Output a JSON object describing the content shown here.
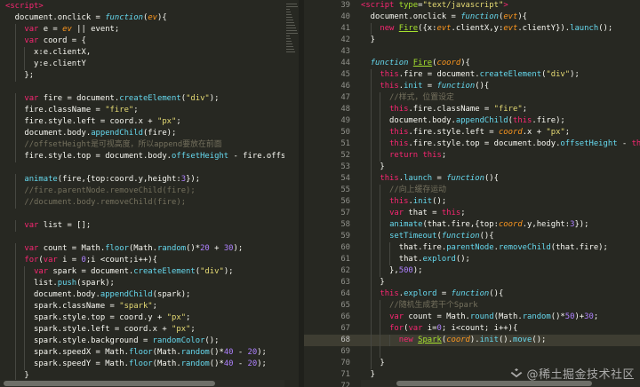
{
  "left_editor": {
    "lines": [
      [
        [
          "<",
          "tg"
        ],
        [
          "script",
          "tg"
        ],
        [
          ">",
          "tg"
        ]
      ],
      [
        [
          "  document.onclick = ",
          "pu"
        ],
        [
          "function",
          "it"
        ],
        [
          "(",
          "pu"
        ],
        [
          "ev",
          "pa"
        ],
        [
          "){",
          "pu"
        ]
      ],
      [
        [
          "    ",
          "pu"
        ],
        [
          "var",
          "kw"
        ],
        [
          " e = ",
          "pu"
        ],
        [
          "ev",
          "pa"
        ],
        [
          " || event;",
          "pu"
        ]
      ],
      [
        [
          "    ",
          "pu"
        ],
        [
          "var",
          "kw"
        ],
        [
          " coord = {",
          "pu"
        ]
      ],
      [
        [
          "      x:e.clientX,",
          "pu"
        ]
      ],
      [
        [
          "      y:e.clientY",
          "pu"
        ]
      ],
      [
        [
          "    };",
          "pu"
        ]
      ],
      [
        [
          "",
          "pu"
        ]
      ],
      [
        [
          "    ",
          "pu"
        ],
        [
          "var",
          "kw"
        ],
        [
          " fire = document.",
          "pu"
        ],
        [
          "createElement",
          "fn"
        ],
        [
          "(",
          "pu"
        ],
        [
          "\"div\"",
          "st"
        ],
        [
          ");",
          "pu"
        ]
      ],
      [
        [
          "    fire.className = ",
          "pu"
        ],
        [
          "\"fire\"",
          "st"
        ],
        [
          ";",
          "pu"
        ]
      ],
      [
        [
          "    fire.style.left = coord.x + ",
          "pu"
        ],
        [
          "\"px\"",
          "st"
        ],
        [
          ";",
          "pu"
        ]
      ],
      [
        [
          "    document.body.",
          "pu"
        ],
        [
          "appendChild",
          "fn"
        ],
        [
          "(fire);",
          "pu"
        ]
      ],
      [
        [
          "    //offsetHeight是可视高度，所以append要放在前面",
          "cm"
        ]
      ],
      [
        [
          "    fire.style.top = document.body.",
          "pu"
        ],
        [
          "offsetHeight",
          "fn"
        ],
        [
          " - fire.offse",
          "pu"
        ]
      ],
      [
        [
          "",
          "pu"
        ]
      ],
      [
        [
          "    ",
          "pu"
        ],
        [
          "animate",
          "fn"
        ],
        [
          "(fire,{top:coord.y,height:",
          "pu"
        ],
        [
          "3",
          "nu"
        ],
        [
          "});",
          "pu"
        ]
      ],
      [
        [
          "    //fire.parentNode.removeChild(fire);",
          "cm"
        ]
      ],
      [
        [
          "    //document.body.removeChild(fire);",
          "cm"
        ]
      ],
      [
        [
          "",
          "pu"
        ]
      ],
      [
        [
          "    ",
          "pu"
        ],
        [
          "var",
          "kw"
        ],
        [
          " list = [];",
          "pu"
        ]
      ],
      [
        [
          "",
          "pu"
        ]
      ],
      [
        [
          "    ",
          "pu"
        ],
        [
          "var",
          "kw"
        ],
        [
          " count = Math.",
          "pu"
        ],
        [
          "floor",
          "fn"
        ],
        [
          "(Math.",
          "pu"
        ],
        [
          "random",
          "fn"
        ],
        [
          "()*",
          "pu"
        ],
        [
          "20",
          "nu"
        ],
        [
          " + ",
          "pu"
        ],
        [
          "30",
          "nu"
        ],
        [
          ");",
          "pu"
        ]
      ],
      [
        [
          "    ",
          "pu"
        ],
        [
          "for",
          "kw"
        ],
        [
          "(",
          "pu"
        ],
        [
          "var",
          "kw"
        ],
        [
          " i = ",
          "pu"
        ],
        [
          "0",
          "nu"
        ],
        [
          ";i <count;i++){",
          "pu"
        ]
      ],
      [
        [
          "      ",
          "pu"
        ],
        [
          "var",
          "kw"
        ],
        [
          " spark = document.",
          "pu"
        ],
        [
          "createElement",
          "fn"
        ],
        [
          "(",
          "pu"
        ],
        [
          "\"div\"",
          "st"
        ],
        [
          ");",
          "pu"
        ]
      ],
      [
        [
          "      list.",
          "pu"
        ],
        [
          "push",
          "fn"
        ],
        [
          "(spark);",
          "pu"
        ]
      ],
      [
        [
          "      document.body.",
          "pu"
        ],
        [
          "appendChild",
          "fn"
        ],
        [
          "(spark);",
          "pu"
        ]
      ],
      [
        [
          "      spark.className = ",
          "pu"
        ],
        [
          "\"spark\"",
          "st"
        ],
        [
          ";",
          "pu"
        ]
      ],
      [
        [
          "      spark.style.top = coord.y + ",
          "pu"
        ],
        [
          "\"px\"",
          "st"
        ],
        [
          ";",
          "pu"
        ]
      ],
      [
        [
          "      spark.style.left = coord.x + ",
          "pu"
        ],
        [
          "\"px\"",
          "st"
        ],
        [
          ";",
          "pu"
        ]
      ],
      [
        [
          "      spark.style.background = ",
          "pu"
        ],
        [
          "randomColor",
          "fn"
        ],
        [
          "();",
          "pu"
        ]
      ],
      [
        [
          "      spark.speedX = Math.",
          "pu"
        ],
        [
          "floor",
          "fn"
        ],
        [
          "(Math.",
          "pu"
        ],
        [
          "random",
          "fn"
        ],
        [
          "()*",
          "pu"
        ],
        [
          "40",
          "nu"
        ],
        [
          " - ",
          "pu"
        ],
        [
          "20",
          "nu"
        ],
        [
          ");",
          "pu"
        ]
      ],
      [
        [
          "      spark.speedY = Math.",
          "pu"
        ],
        [
          "floor",
          "fn"
        ],
        [
          "(Math.",
          "pu"
        ],
        [
          "random",
          "fn"
        ],
        [
          "()*",
          "pu"
        ],
        [
          "40",
          "nu"
        ],
        [
          " - ",
          "pu"
        ],
        [
          "20",
          "nu"
        ],
        [
          ");",
          "pu"
        ]
      ],
      [
        [
          "    }",
          "pu"
        ]
      ],
      [
        [
          "      ",
          "pu"
        ]
      ]
    ]
  },
  "right_editor": {
    "active_line": 68,
    "lines": [
      {
        "n": "39",
        "t": [
          [
            "<",
            "tg"
          ],
          [
            "script",
            "tg"
          ],
          [
            " ",
            "pu"
          ],
          [
            "type",
            "at"
          ],
          [
            "=",
            "pu"
          ],
          [
            "\"text/javascript\"",
            "st"
          ],
          [
            ">",
            "tg"
          ]
        ]
      },
      {
        "n": "40",
        "t": [
          [
            "  document.onclick = ",
            "pu"
          ],
          [
            "function",
            "it"
          ],
          [
            "(",
            "pu"
          ],
          [
            "evt",
            "pa"
          ],
          [
            "){",
            "pu"
          ]
        ]
      },
      {
        "n": "41",
        "t": [
          [
            "    ",
            "pu"
          ],
          [
            "new",
            "kw"
          ],
          [
            " ",
            "pu"
          ],
          [
            "Fire",
            "cl"
          ],
          [
            "({x:",
            "pu"
          ],
          [
            "evt",
            "pa"
          ],
          [
            ".clientX,y:",
            "pu"
          ],
          [
            "evt",
            "pa"
          ],
          [
            ".clientY}).",
            "pu"
          ],
          [
            "launch",
            "fn"
          ],
          [
            "();",
            "pu"
          ]
        ]
      },
      {
        "n": "42",
        "t": [
          [
            "  }",
            "pu"
          ]
        ]
      },
      {
        "n": "43",
        "t": [
          [
            "",
            "pu"
          ]
        ]
      },
      {
        "n": "44",
        "t": [
          [
            "  ",
            "pu"
          ],
          [
            "function",
            "it"
          ],
          [
            " ",
            "pu"
          ],
          [
            "Fire",
            "cl"
          ],
          [
            "(",
            "pu"
          ],
          [
            "coord",
            "pa"
          ],
          [
            "){",
            "pu"
          ]
        ]
      },
      {
        "n": "45",
        "t": [
          [
            "    ",
            "pu"
          ],
          [
            "this",
            "kw"
          ],
          [
            ".fire = document.",
            "pu"
          ],
          [
            "createElement",
            "fn"
          ],
          [
            "(",
            "pu"
          ],
          [
            "\"div\"",
            "st"
          ],
          [
            ");",
            "pu"
          ]
        ]
      },
      {
        "n": "46",
        "t": [
          [
            "    ",
            "pu"
          ],
          [
            "this",
            "kw"
          ],
          [
            ".",
            "pu"
          ],
          [
            "init",
            "fn"
          ],
          [
            " = ",
            "pu"
          ],
          [
            "function",
            "it"
          ],
          [
            "(){",
            "pu"
          ]
        ]
      },
      {
        "n": "47",
        "t": [
          [
            "      //样式，位置设定",
            "cm"
          ]
        ]
      },
      {
        "n": "48",
        "t": [
          [
            "      ",
            "pu"
          ],
          [
            "this",
            "kw"
          ],
          [
            ".fire.className = ",
            "pu"
          ],
          [
            "\"fire\"",
            "st"
          ],
          [
            ";",
            "pu"
          ]
        ]
      },
      {
        "n": "49",
        "t": [
          [
            "      document.body.",
            "pu"
          ],
          [
            "appendChild",
            "fn"
          ],
          [
            "(",
            "pu"
          ],
          [
            "this",
            "kw"
          ],
          [
            ".fire);",
            "pu"
          ]
        ]
      },
      {
        "n": "50",
        "t": [
          [
            "      ",
            "pu"
          ],
          [
            "this",
            "kw"
          ],
          [
            ".fire.style.left = ",
            "pu"
          ],
          [
            "coord",
            "pa"
          ],
          [
            ".x + ",
            "pu"
          ],
          [
            "\"px\"",
            "st"
          ],
          [
            ";",
            "pu"
          ]
        ]
      },
      {
        "n": "51",
        "t": [
          [
            "      ",
            "pu"
          ],
          [
            "this",
            "kw"
          ],
          [
            ".fire.style.top = document.body.",
            "pu"
          ],
          [
            "offsetHeight",
            "fn"
          ],
          [
            " - ",
            "pu"
          ],
          [
            "this",
            "kw"
          ]
        ]
      },
      {
        "n": "52",
        "t": [
          [
            "      ",
            "pu"
          ],
          [
            "return",
            "kw"
          ],
          [
            " ",
            "pu"
          ],
          [
            "this",
            "kw"
          ],
          [
            ";",
            "pu"
          ]
        ]
      },
      {
        "n": "53",
        "t": [
          [
            "    }",
            "pu"
          ]
        ]
      },
      {
        "n": "54",
        "t": [
          [
            "    ",
            "pu"
          ],
          [
            "this",
            "kw"
          ],
          [
            ".",
            "pu"
          ],
          [
            "launch",
            "fn"
          ],
          [
            " = ",
            "pu"
          ],
          [
            "function",
            "it"
          ],
          [
            "(){",
            "pu"
          ]
        ]
      },
      {
        "n": "55",
        "t": [
          [
            "      //向上缓存运动",
            "cm"
          ]
        ]
      },
      {
        "n": "56",
        "t": [
          [
            "      ",
            "pu"
          ],
          [
            "this",
            "kw"
          ],
          [
            ".",
            "pu"
          ],
          [
            "init",
            "fn"
          ],
          [
            "();",
            "pu"
          ]
        ]
      },
      {
        "n": "57",
        "t": [
          [
            "      ",
            "pu"
          ],
          [
            "var",
            "kw"
          ],
          [
            " that = ",
            "pu"
          ],
          [
            "this",
            "kw"
          ],
          [
            ";",
            "pu"
          ]
        ]
      },
      {
        "n": "58",
        "t": [
          [
            "      ",
            "pu"
          ],
          [
            "animate",
            "fn"
          ],
          [
            "(that.fire,{top:",
            "pu"
          ],
          [
            "coord",
            "pa"
          ],
          [
            ".y,height:",
            "pu"
          ],
          [
            "3",
            "nu"
          ],
          [
            "});",
            "pu"
          ]
        ]
      },
      {
        "n": "59",
        "t": [
          [
            "      ",
            "pu"
          ],
          [
            "setTimeout",
            "fn"
          ],
          [
            "(",
            "pu"
          ],
          [
            "function",
            "it"
          ],
          [
            "(){",
            "pu"
          ]
        ]
      },
      {
        "n": "60",
        "t": [
          [
            "        that.fire.",
            "pu"
          ],
          [
            "parentNode",
            "fn"
          ],
          [
            ".",
            "pu"
          ],
          [
            "removeChild",
            "fn"
          ],
          [
            "(that.fire);",
            "pu"
          ]
        ]
      },
      {
        "n": "61",
        "t": [
          [
            "        that.",
            "pu"
          ],
          [
            "explord",
            "fn"
          ],
          [
            "();",
            "pu"
          ]
        ]
      },
      {
        "n": "62",
        "t": [
          [
            "      },",
            "pu"
          ],
          [
            "500",
            "nu"
          ],
          [
            ");",
            "pu"
          ]
        ]
      },
      {
        "n": "63",
        "t": [
          [
            "    }",
            "pu"
          ]
        ]
      },
      {
        "n": "64",
        "t": [
          [
            "    ",
            "pu"
          ],
          [
            "this",
            "kw"
          ],
          [
            ".",
            "pu"
          ],
          [
            "explord",
            "fn"
          ],
          [
            " = ",
            "pu"
          ],
          [
            "function",
            "it"
          ],
          [
            "(){",
            "pu"
          ]
        ]
      },
      {
        "n": "65",
        "t": [
          [
            "      //随机生成若干个Spark",
            "cm"
          ]
        ]
      },
      {
        "n": "66",
        "t": [
          [
            "      ",
            "pu"
          ],
          [
            "var",
            "kw"
          ],
          [
            " count = Math.",
            "pu"
          ],
          [
            "round",
            "fn"
          ],
          [
            "(Math.",
            "pu"
          ],
          [
            "random",
            "fn"
          ],
          [
            "()*",
            "pu"
          ],
          [
            "50",
            "nu"
          ],
          [
            ")+",
            "pu"
          ],
          [
            "30",
            "nu"
          ],
          [
            ";",
            "pu"
          ]
        ]
      },
      {
        "n": "67",
        "t": [
          [
            "      ",
            "pu"
          ],
          [
            "for",
            "kw"
          ],
          [
            "(",
            "pu"
          ],
          [
            "var",
            "kw"
          ],
          [
            " i=",
            "pu"
          ],
          [
            "0",
            "nu"
          ],
          [
            "; i<count; i++){",
            "pu"
          ]
        ]
      },
      {
        "n": "68",
        "t": [
          [
            "        ",
            "pu"
          ],
          [
            "new",
            "kw"
          ],
          [
            " ",
            "pu"
          ],
          [
            "Spark",
            "cl"
          ],
          [
            "(",
            "pu"
          ],
          [
            "coord",
            "pa"
          ],
          [
            ").",
            "pu"
          ],
          [
            "init",
            "fn"
          ],
          [
            "().",
            "pu"
          ],
          [
            "move",
            "fn"
          ],
          [
            "();",
            "pu"
          ]
        ]
      },
      {
        "n": "69",
        "t": [
          [
            "      ",
            "pu"
          ]
        ]
      },
      {
        "n": "70",
        "t": [
          [
            "    }",
            "pu"
          ]
        ]
      },
      {
        "n": "71",
        "t": [
          [
            "  }",
            "pu"
          ]
        ]
      },
      {
        "n": "72",
        "t": [
          [
            "",
            "pu"
          ]
        ]
      }
    ]
  },
  "watermark": "@稀土掘金技术社区",
  "colors": {
    "background": "#272822",
    "keyword": "#f92672",
    "function": "#66d9ef",
    "string": "#e6db74",
    "number": "#ae81ff",
    "comment": "#75715e",
    "param": "#fd971f",
    "class": "#a6e22e"
  }
}
